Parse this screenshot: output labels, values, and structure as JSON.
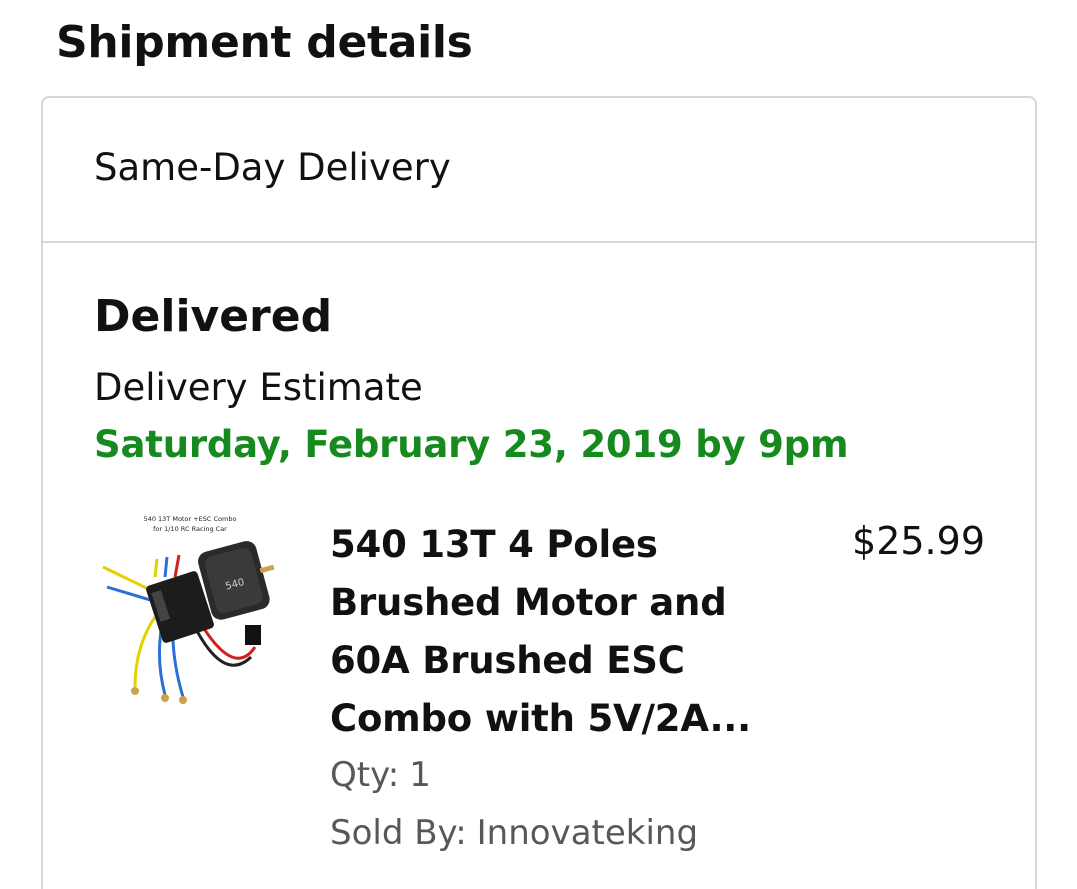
{
  "section": {
    "title": "Shipment details"
  },
  "shipment": {
    "delivery_type": "Same-Day Delivery",
    "status": "Delivered",
    "estimate_label": "Delivery Estimate",
    "estimate_date": "Saturday, February 23, 2019 by 9pm",
    "status_color": "#178a1f"
  },
  "item": {
    "image_caption_line1": "540 13T Motor +ESC Combo",
    "image_caption_line2": "for 1/10 RC Racing Car",
    "title_lines": [
      "540 13T 4 Poles",
      "Brushed Motor and",
      "60A Brushed ESC",
      "Combo with 5V/2A..."
    ],
    "price": "$25.99",
    "qty_label": "Qty:",
    "qty_value": "1",
    "seller_label": "Sold By:",
    "seller_value": "Innovateking",
    "image_icon": "motor-esc-product-photo"
  }
}
